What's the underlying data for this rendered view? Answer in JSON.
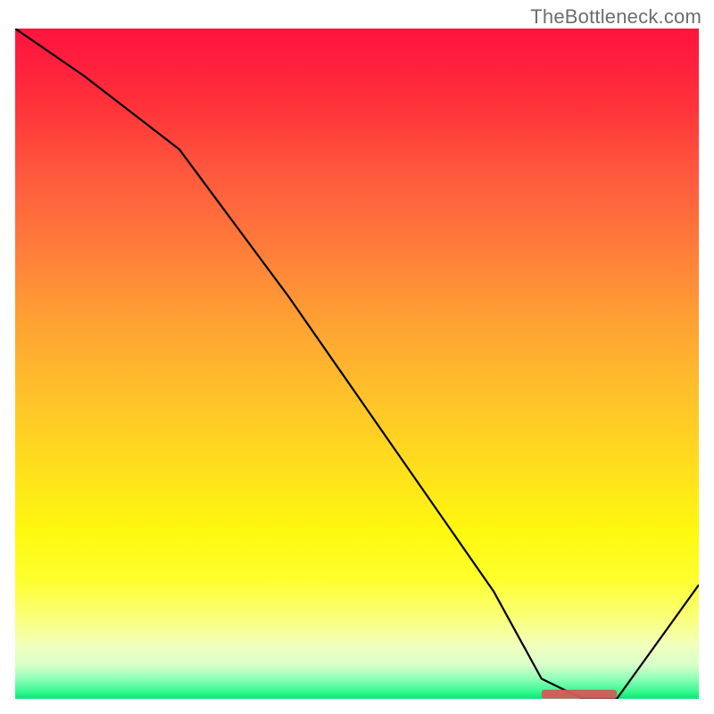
{
  "watermark": "TheBottleneck.com",
  "chart_data": {
    "type": "line",
    "title": "",
    "xlabel": "",
    "ylabel": "",
    "xlim": [
      0,
      100
    ],
    "ylim": [
      0,
      100
    ],
    "background_gradient": {
      "top_color": "#ff143c",
      "bottom_color": "#0ee479",
      "description": "vertical gradient from red (high) through orange, yellow to green (low)"
    },
    "series": [
      {
        "name": "bottleneck-curve",
        "x": [
          0,
          10,
          24,
          40,
          55,
          70,
          77,
          83,
          88,
          100
        ],
        "y": [
          100,
          93,
          82,
          60,
          38,
          16,
          3,
          0,
          0,
          17
        ]
      }
    ],
    "highlight_band": {
      "x_start": 77,
      "x_end": 88,
      "y": 0.7,
      "color": "#d45a58",
      "description": "flat minimum region near x-axis"
    }
  }
}
